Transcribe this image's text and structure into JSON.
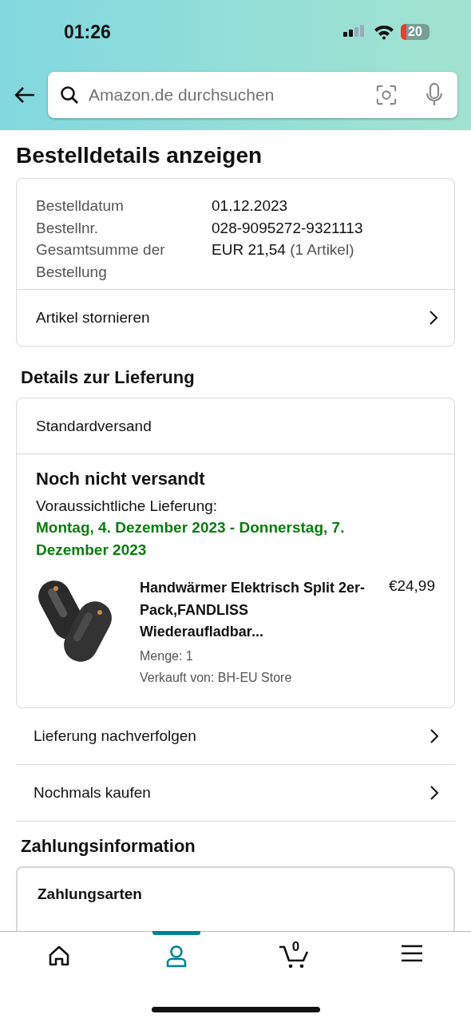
{
  "status_bar": {
    "time": "01:26",
    "battery": "20"
  },
  "search": {
    "placeholder": "Amazon.de durchsuchen"
  },
  "title": "Bestelldetails anzeigen",
  "summary": {
    "rows": [
      {
        "label": "Bestelldatum",
        "value": "01.12.2023"
      },
      {
        "label": "Bestellnr.",
        "value": "028-9095272-9321113"
      },
      {
        "label": "Gesamtsumme der Bestellung",
        "value": "EUR 21,54",
        "note": "(1 Artikel)"
      }
    ],
    "link": "Artikel stornieren"
  },
  "delivery": {
    "heading": "Details zur Lieferung",
    "shipping": "Standardversand",
    "status": "Noch nicht versandt",
    "eta_label": "Voraussichtliche Lieferung:",
    "eta": "Montag, 4. Dezember 2023 - Donnerstag, 7. Dezember 2023",
    "item": {
      "title": "Handwärmer Elektrisch Split 2er-Pack,FANDLISS Wiederaufladbar...",
      "price": "€24,99",
      "quantity": "Menge: 1",
      "seller": "Verkauft von: BH-EU Store"
    }
  },
  "actions": [
    "Lieferung nachverfolgen",
    "Nochmals kaufen"
  ],
  "payment": {
    "heading": "Zahlungsinformation",
    "card_title": "Zahlungsarten"
  },
  "nav": [
    {
      "kind": "home",
      "selected": false
    },
    {
      "kind": "account",
      "selected": true
    },
    {
      "kind": "cart",
      "count": "0",
      "selected": false
    },
    {
      "kind": "menu",
      "selected": false
    }
  ]
}
